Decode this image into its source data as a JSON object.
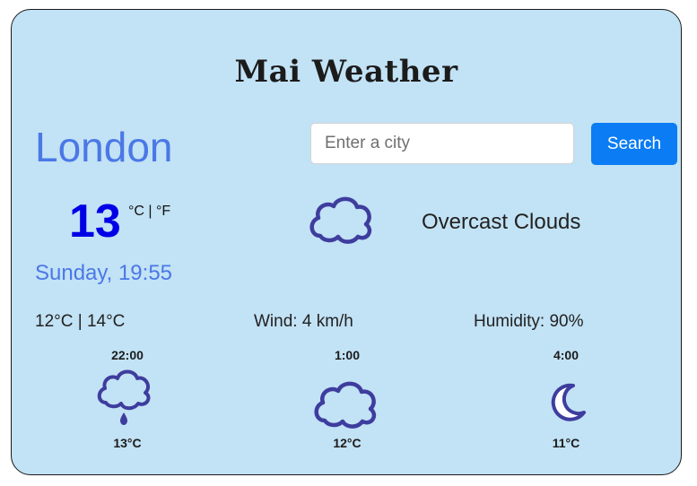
{
  "header": {
    "title": "Mai Weather"
  },
  "search": {
    "placeholder": "Enter a city",
    "button_label": "Search"
  },
  "current": {
    "city": "London",
    "temperature": "13",
    "units": "°C | °F",
    "description": "Overcast Clouds",
    "icon": "cloud-icon",
    "datetime": "Sunday, 19:55",
    "range": "12°C | 14°C",
    "wind": "Wind: 4 km/h",
    "humidity": "Humidity: 90%"
  },
  "forecast": [
    {
      "time": "22:00",
      "icon": "rain-cloud-icon",
      "temp": "13°C"
    },
    {
      "time": "1:00",
      "icon": "cloud-icon",
      "temp": "12°C"
    },
    {
      "time": "4:00",
      "icon": "crescent-moon-icon",
      "temp": "11°C"
    }
  ],
  "colors": {
    "background": "#c2e2f5",
    "accent": "#4a78e6",
    "temperature": "#0000e6",
    "button": "#0b7cf4",
    "icon_stroke": "#3e3d9e"
  }
}
